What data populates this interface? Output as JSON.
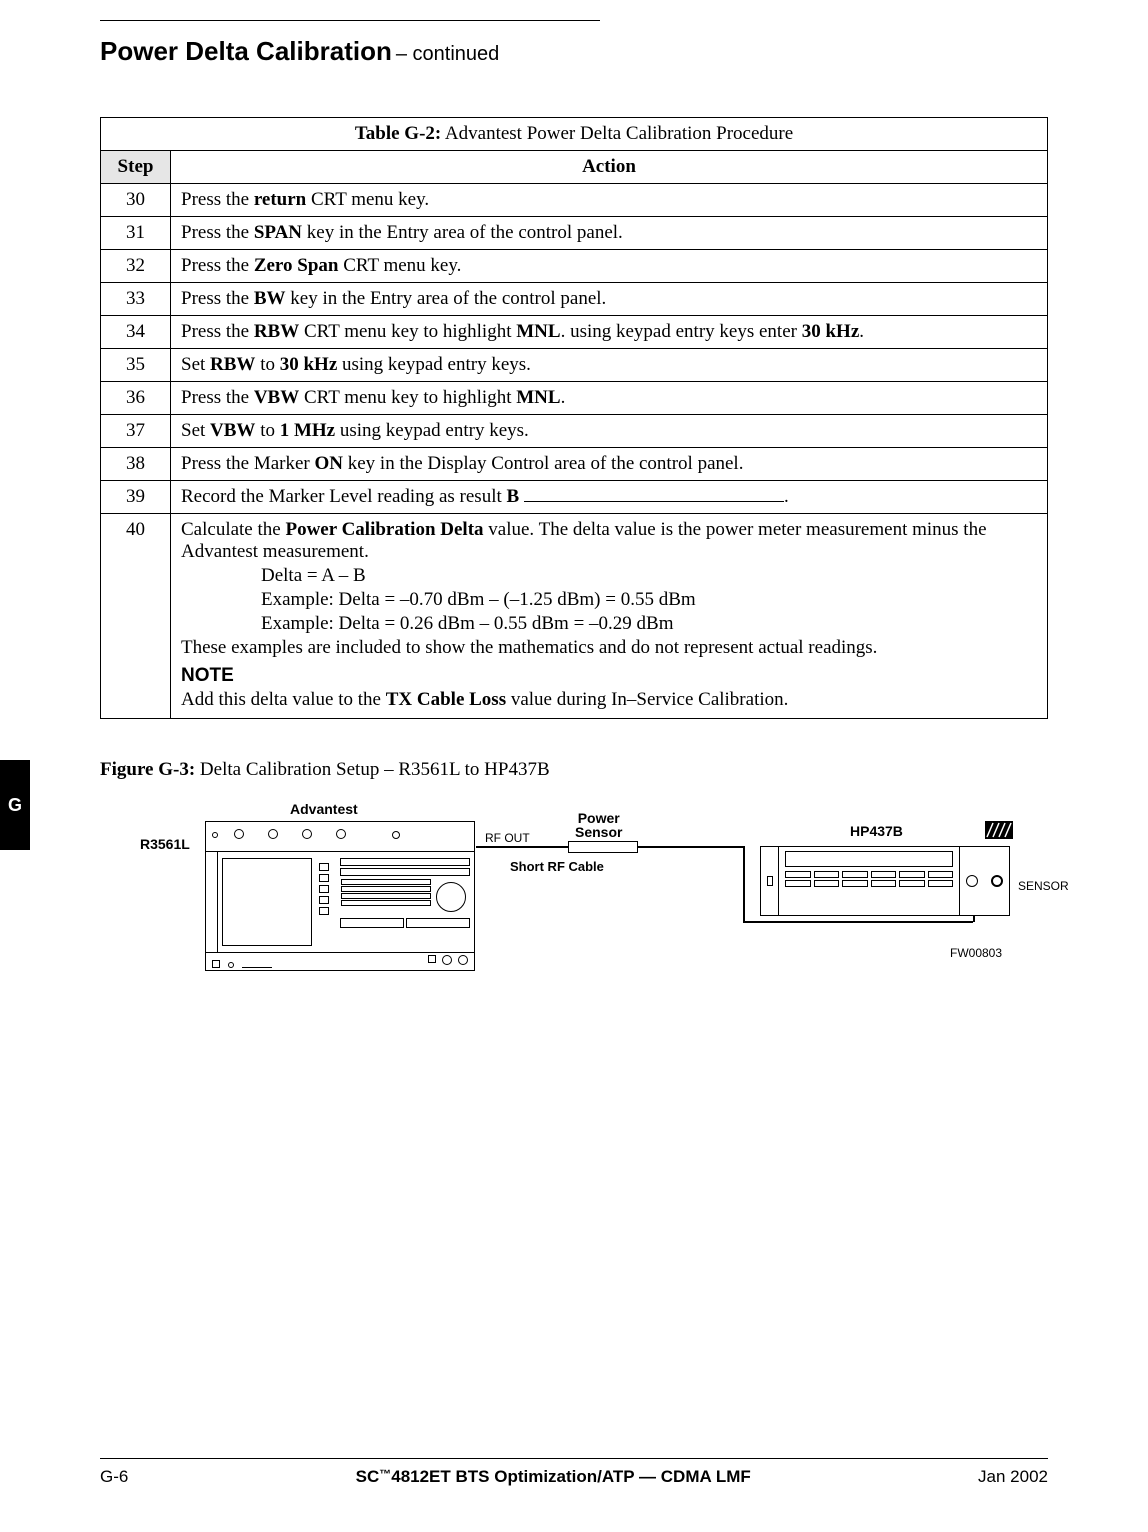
{
  "title": {
    "main": "Power Delta Calibration",
    "sub": " – continued"
  },
  "table": {
    "caption_prefix": "Table G-2:",
    "caption": " Advantest Power Delta Calibration Procedure",
    "head_step": "Step",
    "head_action": "Action",
    "rows": [
      {
        "step": "30",
        "action_parts": [
          "Press the ",
          "return",
          " CRT menu key."
        ]
      },
      {
        "step": "31",
        "action_parts": [
          "Press the ",
          "SPAN",
          " key in the Entry area of the control panel."
        ]
      },
      {
        "step": "32",
        "action_parts": [
          "Press the ",
          "Zero Span",
          " CRT menu key."
        ]
      },
      {
        "step": "33",
        "action_parts": [
          "Press the ",
          "BW",
          " key in the Entry area of the control panel."
        ]
      },
      {
        "step": "34",
        "action_parts": [
          "Press the ",
          "RBW",
          " CRT menu key to highlight ",
          "MNL",
          ". using keypad entry keys enter ",
          "30 kHz",
          "."
        ]
      },
      {
        "step": "35",
        "action_parts": [
          "Set ",
          "RBW",
          " to ",
          "30 kHz",
          " using keypad entry keys."
        ]
      },
      {
        "step": "36",
        "action_parts": [
          "Press the ",
          "VBW",
          " CRT menu key to highlight ",
          "MNL",
          "."
        ]
      },
      {
        "step": "37",
        "action_parts": [
          "Set ",
          "VBW",
          " to ",
          "1 MHz",
          " using keypad entry keys."
        ]
      },
      {
        "step": "38",
        "action_parts": [
          "Press the Marker ",
          "ON",
          " key in the Display Control area of the control panel."
        ]
      },
      {
        "step": "39",
        "action_parts": [
          "Record the Marker Level reading as result ",
          "B",
          " "
        ],
        "trailing_blank": true,
        "trailing_period": "."
      }
    ],
    "row40": {
      "step": "40",
      "intro_pre": "Calculate the ",
      "intro_bold": "Power Calibration Delta",
      "intro_post": " value. The delta value is the power meter measurement minus the Advantest measurement.",
      "delta_eq": "Delta = A – B",
      "ex1": "Example: Delta = –0.70 dBm – (–1.25 dBm) = 0.55 dBm",
      "ex2": "Example: Delta = 0.26 dBm – 0.55 dBm = –0.29 dBm",
      "disclaimer": "These examples are included to show the mathematics and do not represent actual readings.",
      "note_head": "NOTE",
      "note_text_pre": "Add this delta value to the ",
      "note_text_bold": "TX Cable Loss",
      "note_text_post": " value during In–Service Calibration."
    }
  },
  "figure": {
    "caption_prefix": "Figure G-3:",
    "caption": " Delta Calibration Setup – R3561L to HP437B",
    "labels": {
      "advantest": "Advantest",
      "r3561l": "R3561L",
      "rfout": "RF OUT",
      "power_sensor_l1": "Power",
      "power_sensor_l2": "Sensor",
      "short_cable": "Short RF Cable",
      "hp437b": "HP437B",
      "sensor": "SENSOR",
      "fwcode": "FW00803"
    }
  },
  "tab_letter": "G",
  "footer": {
    "left": "G-6",
    "center_pre": "SC",
    "center_tm": "™",
    "center_post": "4812ET BTS Optimization/ATP — CDMA LMF",
    "right": "Jan 2002"
  }
}
